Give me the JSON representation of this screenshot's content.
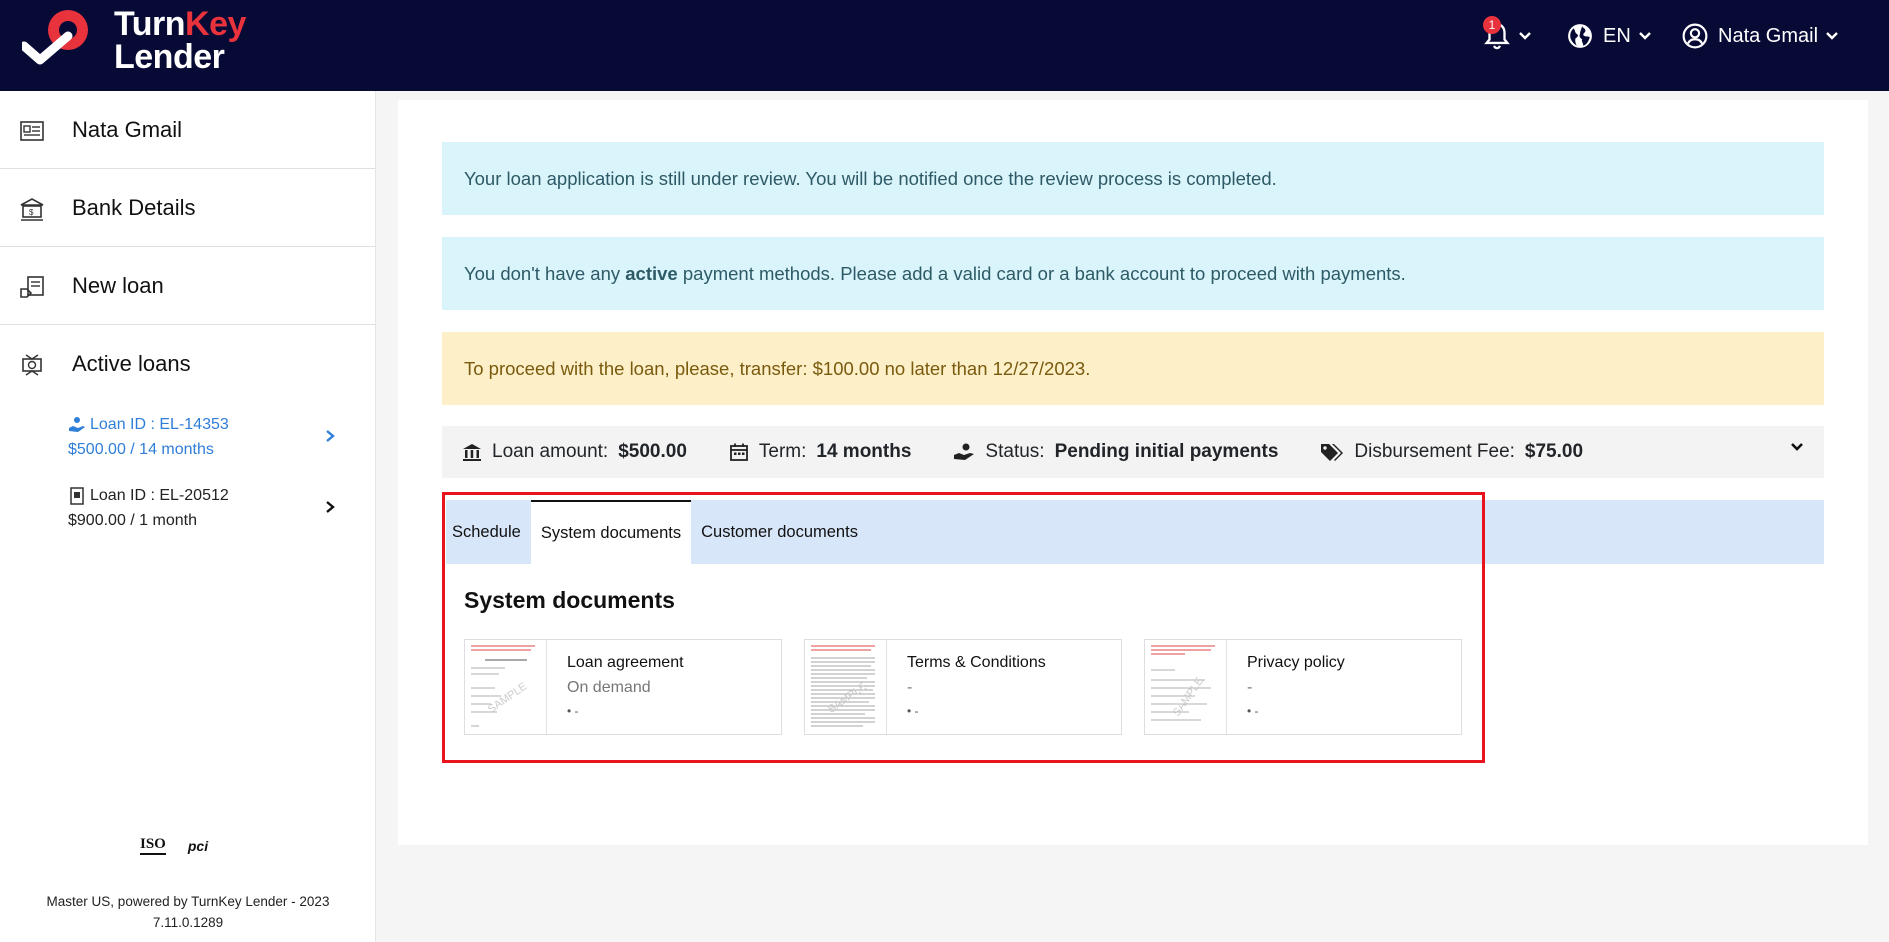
{
  "header": {
    "brand_line1_a": "Turn",
    "brand_line1_b": "Key",
    "brand_line2": "Lender",
    "notification_count": "1",
    "language": "EN",
    "user_name": "Nata Gmail"
  },
  "sidebar": {
    "items": [
      {
        "label": "Nata Gmail",
        "icon": "profile-card-icon"
      },
      {
        "label": "Bank Details",
        "icon": "bank-icon"
      },
      {
        "label": "New loan",
        "icon": "new-loan-icon"
      },
      {
        "label": "Active loans",
        "icon": "active-loans-icon"
      }
    ],
    "loans": [
      {
        "id": "Loan ID : EL-14353",
        "summary": "$500.00 / 14 months"
      },
      {
        "id": "Loan ID : EL-20512",
        "summary": "$900.00 / 1 month"
      }
    ],
    "certs": [
      "ISO",
      "pci"
    ],
    "footer_line1": "Master US, powered by TurnKey Lender - 2023",
    "footer_line2": "7.11.0.1289"
  },
  "alerts": {
    "review": "Your loan application is still under review. You will be notified once the review process is completed.",
    "payment_a": "You don't have any ",
    "payment_b": "active",
    "payment_c": " payment methods. Please add a valid card or a bank account to proceed with payments.",
    "transfer": "To proceed with the loan, please, transfer: $100.00 no later than 12/27/2023."
  },
  "summary": {
    "loan_amount_label": "Loan amount:",
    "loan_amount": "$500.00",
    "term_label": "Term:",
    "term": "14 months",
    "status_label": "Status:",
    "status": "Pending initial payments",
    "fee_label": "Disbursement Fee:",
    "fee": "$75.00"
  },
  "tabs": [
    "Schedule",
    "System documents",
    "Customer documents"
  ],
  "section_title": "System documents",
  "documents": [
    {
      "name": "Loan agreement",
      "sub": "On demand",
      "meta": "• -"
    },
    {
      "name": "Terms & Conditions",
      "sub": "-",
      "meta": "• -"
    },
    {
      "name": "Privacy policy",
      "sub": "-",
      "meta": "• -"
    }
  ],
  "colors": {
    "header_bg": "#080a36",
    "brand_red": "#e8323c",
    "active_link": "#2f7ed8",
    "info_bg": "#d9f4fb",
    "warn_bg": "#fdf0c8",
    "tabs_bg": "#d7e6f9",
    "highlight": "#e8131c"
  }
}
